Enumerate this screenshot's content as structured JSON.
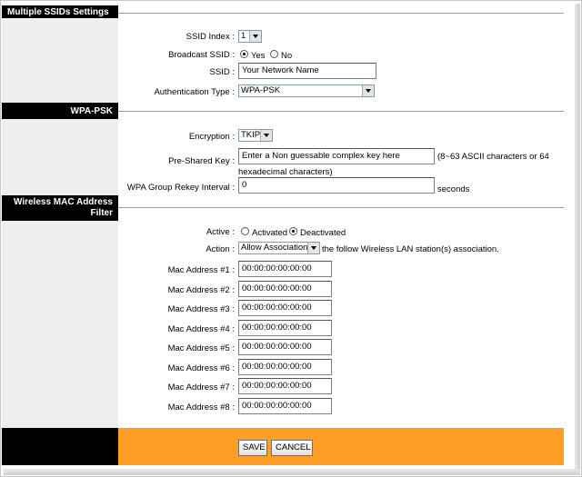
{
  "sections": {
    "multiple_ssids": "Multiple SSIDs Settings",
    "wpa_psk": "WPA-PSK",
    "mac_filter_line1": "Wireless MAC Address",
    "mac_filter_line2": "Filter"
  },
  "ssid_settings": {
    "ssid_index_label": "SSID Index :",
    "ssid_index_value": "1",
    "broadcast_label": "Broadcast SSID :",
    "broadcast_yes": "Yes",
    "broadcast_no": "No",
    "broadcast_selected": "Yes",
    "ssid_label": "SSID :",
    "ssid_value": "Your Network Name",
    "auth_label": "Authentication Type :",
    "auth_value": "WPA-PSK"
  },
  "wpa": {
    "encryption_label": "Encryption :",
    "encryption_value": "TKIP",
    "psk_label": "Pre-Shared Key :",
    "psk_value": "Enter a Non guessable complex key here",
    "psk_hint_1": "(8~63 ASCII characters or 64",
    "psk_hint_2": "hexadecimal characters)",
    "rekey_label": "WPA Group Rekey Interval :",
    "rekey_value": "0",
    "rekey_unit": "seconds"
  },
  "mac_filter": {
    "active_label": "Active :",
    "activated": "Activated",
    "deactivated": "Deactivated",
    "active_selected": "Deactivated",
    "action_label": "Action :",
    "action_value": "Allow Association",
    "action_suffix": "the follow Wireless LAN station(s) association.",
    "addresses": [
      {
        "label": "Mac Address #1 :",
        "value": "00:00:00:00:00:00"
      },
      {
        "label": "Mac Address #2 :",
        "value": "00:00:00:00:00:00"
      },
      {
        "label": "Mac Address #3 :",
        "value": "00:00:00:00:00:00"
      },
      {
        "label": "Mac Address #4 :",
        "value": "00:00:00:00:00:00"
      },
      {
        "label": "Mac Address #5 :",
        "value": "00:00:00:00:00:00"
      },
      {
        "label": "Mac Address #6 :",
        "value": "00:00:00:00:00:00"
      },
      {
        "label": "Mac Address #7 :",
        "value": "00:00:00:00:00:00"
      },
      {
        "label": "Mac Address #8 :",
        "value": "00:00:00:00:00:00"
      }
    ]
  },
  "buttons": {
    "save": "SAVE",
    "cancel": "CANCEL"
  },
  "colors": {
    "footer_accent": "#ff9e27",
    "section_header": "#000000",
    "left_column": "#efefef"
  }
}
